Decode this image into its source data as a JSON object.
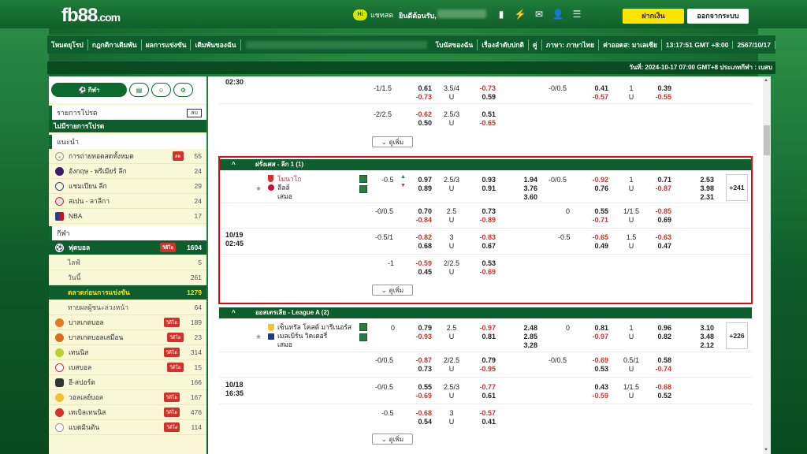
{
  "brand": {
    "logo": "fb88",
    "logo_suffix": ".com"
  },
  "header": {
    "chat_label": "แชทสด",
    "welcome": "ยินดีต้อนรับ,",
    "deposit": "ฝากเงิน",
    "logout": "ออกจากระบบ"
  },
  "nav": {
    "items": [
      "โหมดยุโรป",
      "กฎกติกาเดิมพัน",
      "ผลการแข่งขัน",
      "เดิมพันของฉัน",
      "โบนัสของฉัน",
      "เรื่องลำดับปกติ",
      "คู่",
      "ภาษา: ภาษาไทย",
      "ค่าออดส: มาเลเซีย",
      "13:17:51 GMT +8:00",
      "2567/10/17"
    ]
  },
  "datebar": "วันที่: 2024-10-17 07:00 GMT+8 ประเภทกีฬา : เบสบ",
  "sidebar": {
    "tab_sport": "กีฬา",
    "favorites_title": "รายการโปรด",
    "favorites_btn": "ลบ",
    "no_favorites": "ไม่มีรายการโปรด",
    "recommended_title": "แนะนำ",
    "recommended": [
      {
        "name": "การถ่ายทอดสดทั้งหมด",
        "count": "55",
        "live": "สด"
      },
      {
        "name": "อังกฤษ - พรีเมียร์ ลีก",
        "count": "24"
      },
      {
        "name": "แชมเปียน ลีก",
        "count": "29"
      },
      {
        "name": "สเปน - ลาลีกา",
        "count": "24"
      },
      {
        "name": "NBA",
        "count": "17"
      }
    ],
    "sports_title": "กีฬา",
    "live_label": "วิดีโอ",
    "football": {
      "name": "ฟุตบอล",
      "count": "1604"
    },
    "football_sub": [
      {
        "name": "ไลฟ์",
        "count": "5"
      },
      {
        "name": "วันนี้",
        "count": "261"
      }
    ],
    "football_active": {
      "name": "ตลาดก่อนการแข่งขัน",
      "count": "1279"
    },
    "football_after": {
      "name": "ทายผลผู้ชนะล่วงหน้า",
      "count": "64"
    },
    "sports": [
      {
        "name": "บาสเกตบอล",
        "count": "189"
      },
      {
        "name": "บาสเกตบอลเสมือน",
        "count": "23"
      },
      {
        "name": "เทนนิส",
        "count": "314"
      },
      {
        "name": "เบสบอล",
        "count": "15"
      },
      {
        "name": "อี-สปอร์ต",
        "count": "166"
      },
      {
        "name": "วอลเลย์บอล",
        "count": "167"
      },
      {
        "name": "เทเบิลเทนนิส",
        "count": "476"
      },
      {
        "name": "แบดมินตัน",
        "count": "114"
      }
    ]
  },
  "main": {
    "more_label": "ดูเพิ่ม",
    "top_time": "02:30",
    "top_rows": [
      {
        "hdp": "-1/1.5",
        "h1": "0.61",
        "h2": "-0.73",
        "ou": "3.5/4",
        "u": "U",
        "o1": "-0.73",
        "o2": "0.59",
        "hhdp": "-0/0.5",
        "hh1": "0.41",
        "hh2": "-0.57",
        "hou": "1",
        "hu": "U",
        "ho1": "0.39",
        "ho2": "-0.55"
      },
      {
        "hdp": "-2/2.5",
        "h1": "-0.62",
        "h2": "0.50",
        "ou": "2.5/3",
        "u": "U",
        "o1": "0.51",
        "o2": "-0.65"
      }
    ],
    "league1": {
      "name": "ฝรั่งเศส - ลีก 1 (1)",
      "date": "10/19",
      "time": "02:45",
      "home": "โมนาโก",
      "away": "ลีลล์",
      "draw": "เสมอ",
      "plus": "+241",
      "x12": [
        "1.94",
        "3.76",
        "3.60"
      ],
      "hx12": [
        "2.53",
        "3.98",
        "2.31"
      ],
      "rows": [
        {
          "hdp": "-0.5",
          "h1": "0.97",
          "h2": "0.89",
          "ou": "2.5/3",
          "u": "U",
          "o1": "0.93",
          "o2": "0.91",
          "hhdp": "-0/0.5",
          "hh1": "-0.92",
          "hh2": "0.76",
          "hou": "1",
          "hu": "U",
          "ho1": "0.71",
          "ho2": "-0.87"
        },
        {
          "hdp": "-0/0.5",
          "h1": "0.70",
          "h2": "-0.84",
          "ou": "2.5",
          "u": "U",
          "o1": "0.73",
          "o2": "-0.89",
          "hhdp": "0",
          "hh1": "0.55",
          "hh2": "-0.71",
          "hou": "1/1.5",
          "hu": "U",
          "ho1": "-0.85",
          "ho2": "0.69"
        },
        {
          "hdp": "-0.5/1",
          "h1": "-0.82",
          "h2": "0.68",
          "ou": "3",
          "u": "U",
          "o1": "-0.83",
          "o2": "0.67",
          "hhdp": "-0.5",
          "hh1": "-0.65",
          "hh2": "0.49",
          "hou": "1.5",
          "hu": "U",
          "ho1": "-0.63",
          "ho2": "0.47"
        },
        {
          "hdp": "-1",
          "h1": "-0.59",
          "h2": "0.45",
          "ou": "2/2.5",
          "u": "U",
          "o1": "0.53",
          "o2": "-0.69"
        }
      ]
    },
    "league2": {
      "name": "ออสเตรเลีย - League A (2)",
      "date": "10/18",
      "time": "16:35",
      "home": "เซ็นทรัล โคสต์ มารีเนอร์ส",
      "away": "เมลเบิร์น วิคเตอรี่",
      "draw": "เสมอ",
      "plus": "+226",
      "x12": [
        "2.48",
        "2.85",
        "3.28"
      ],
      "hx12": [
        "3.10",
        "3.48",
        "2.12"
      ],
      "rows": [
        {
          "hdp": "0",
          "h1": "0.79",
          "h2": "-0.93",
          "ou": "2.5",
          "u": "U",
          "o1": "-0.97",
          "o2": "0.81",
          "hhdp": "0",
          "hh1": "0.81",
          "hh2": "-0.97",
          "hou": "1",
          "hu": "U",
          "ho1": "0.96",
          "ho2": "0.82"
        },
        {
          "hdp": "-0/0.5",
          "h1": "-0.87",
          "h2": "0.73",
          "ou": "2/2.5",
          "u": "U",
          "o1": "0.79",
          "o2": "-0.95",
          "hhdp": "-0/0.5",
          "hh1": "-0.69",
          "hh2": "0.53",
          "hou": "0.5/1",
          "hu": "U",
          "ho1": "0.58",
          "ho2": "-0.74"
        },
        {
          "hdp": "-0/0.5",
          "h1": "0.55",
          "h2": "-0.69",
          "ou": "2.5/3",
          "u": "U",
          "o1": "-0.77",
          "o2": "0.61",
          "hhdp": "",
          "hh1": "0.43",
          "hh2": "-0.59",
          "hou": "1/1.5",
          "hu": "U",
          "ho1": "-0.68",
          "ho2": "0.52"
        },
        {
          "hdp": "-0.5",
          "h1": "-0.68",
          "h2": "0.54",
          "ou": "3",
          "u": "U",
          "o1": "-0.57",
          "o2": "0.41"
        }
      ]
    }
  },
  "colors": {
    "brand_green": "#0d5e2c",
    "accent_yellow": "#ffe400",
    "negative_red": "#d3312b",
    "highlight_border": "#e30613"
  }
}
